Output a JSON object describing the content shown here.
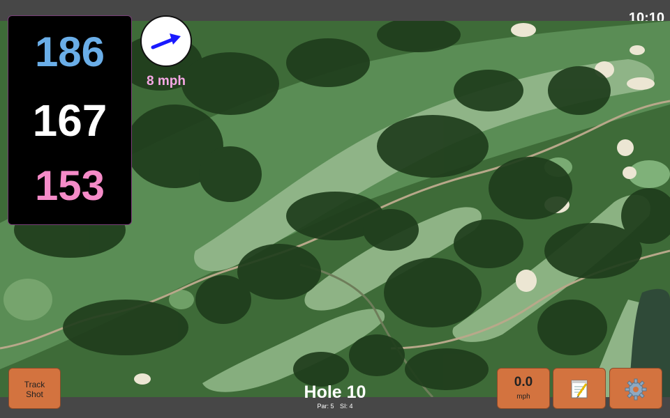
{
  "status": {
    "time": "10:10"
  },
  "distances": {
    "back": "186",
    "center": "167",
    "front": "153"
  },
  "wind": {
    "speed_label": "8 mph",
    "icon": "wind-direction-arrow-icon"
  },
  "hole": {
    "title": "Hole 10",
    "par_label": "Par: 5",
    "si_label": "SI: 4"
  },
  "controls": {
    "track_shot_label_line1": "Track",
    "track_shot_label_line2": "Shot",
    "speed_value": "0.0",
    "speed_unit": "mph",
    "notes_icon": "notepad-icon",
    "settings_icon": "gear-icon"
  },
  "colors": {
    "back_distance": "#6aaee8",
    "center_distance": "#ffffff",
    "front_distance": "#f58bc8",
    "wind_label": "#f7a8e6",
    "button": "#d3733f"
  }
}
